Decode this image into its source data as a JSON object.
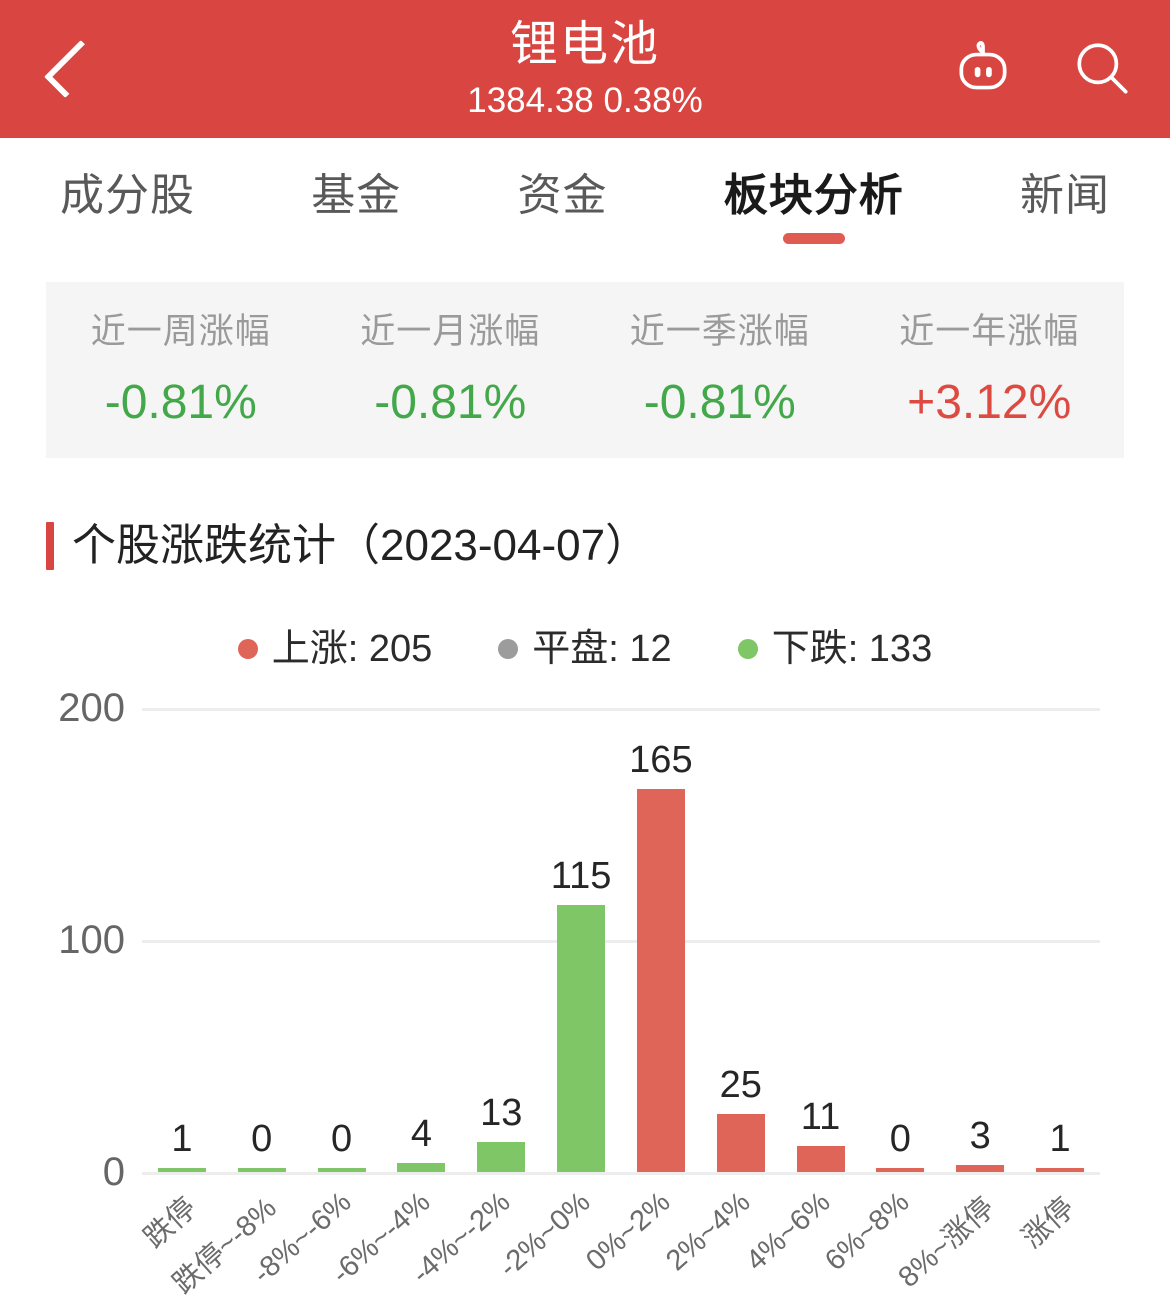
{
  "header": {
    "back_icon": "chevron-left-icon",
    "index_name": "锂电池",
    "index_quote": "1384.38 0.38%",
    "robot_icon": "robot-icon",
    "search_icon": "search-icon",
    "background_color": "#d94540"
  },
  "tabs": {
    "items": [
      {
        "label": "成分股",
        "active": false
      },
      {
        "label": "基金",
        "active": false
      },
      {
        "label": "资金",
        "active": false
      },
      {
        "label": "板块分析",
        "active": true
      },
      {
        "label": "新闻",
        "active": false
      }
    ],
    "active_indicator_color": "#e05c52"
  },
  "stats": {
    "items": [
      {
        "label": "近一周涨幅",
        "value": "-0.81%",
        "direction": "down"
      },
      {
        "label": "近一月涨幅",
        "value": "-0.81%",
        "direction": "down"
      },
      {
        "label": "近一季涨幅",
        "value": "-0.81%",
        "direction": "down"
      },
      {
        "label": "近一年涨幅",
        "value": "+3.12%",
        "direction": "up"
      }
    ],
    "down_color": "#43a84a",
    "up_color": "#dc4a41",
    "panel_color": "#f5f5f5"
  },
  "section": {
    "title": "个股涨跌统计（2023-04-07）",
    "accent_color": "#d94540"
  },
  "legend": [
    {
      "label": "上涨: 205",
      "color": "#df6559"
    },
    {
      "label": "平盘: 12",
      "color": "#9c9c9c"
    },
    {
      "label": "下跌: 133",
      "color": "#7fc766"
    }
  ],
  "chart_data": {
    "type": "bar",
    "title": "个股涨跌统计（2023-04-07）",
    "xlabel": "",
    "ylabel": "",
    "ylim": [
      0,
      200
    ],
    "yticks": [
      0,
      100,
      200
    ],
    "ytick_labels": [
      "0",
      "100",
      "200"
    ],
    "grid": true,
    "legend_position": "top-center",
    "categories": [
      "跌停",
      "跌停~-8%",
      "-8%~-6%",
      "-6%~-4%",
      "-4%~-2%",
      "-2%~0%",
      "0%~2%",
      "2%~4%",
      "4%~6%",
      "6%~8%",
      "8%~涨停",
      "涨停"
    ],
    "values": [
      1,
      0,
      0,
      4,
      13,
      115,
      165,
      25,
      11,
      0,
      3,
      1
    ],
    "bar_colors": [
      "#7fc766",
      "#7fc766",
      "#7fc766",
      "#7fc766",
      "#7fc766",
      "#7fc766",
      "#df6559",
      "#df6559",
      "#df6559",
      "#df6559",
      "#df6559",
      "#df6559"
    ],
    "value_labels": [
      "1",
      "0",
      "0",
      "4",
      "13",
      "115",
      "165",
      "25",
      "11",
      "0",
      "3",
      "1"
    ],
    "series": [
      {
        "name": "下跌",
        "color": "#7fc766",
        "values": [
          1,
          0,
          0,
          4,
          13,
          115
        ]
      },
      {
        "name": "上涨",
        "color": "#df6559",
        "values": [
          165,
          25,
          11,
          0,
          3,
          1
        ]
      }
    ]
  }
}
